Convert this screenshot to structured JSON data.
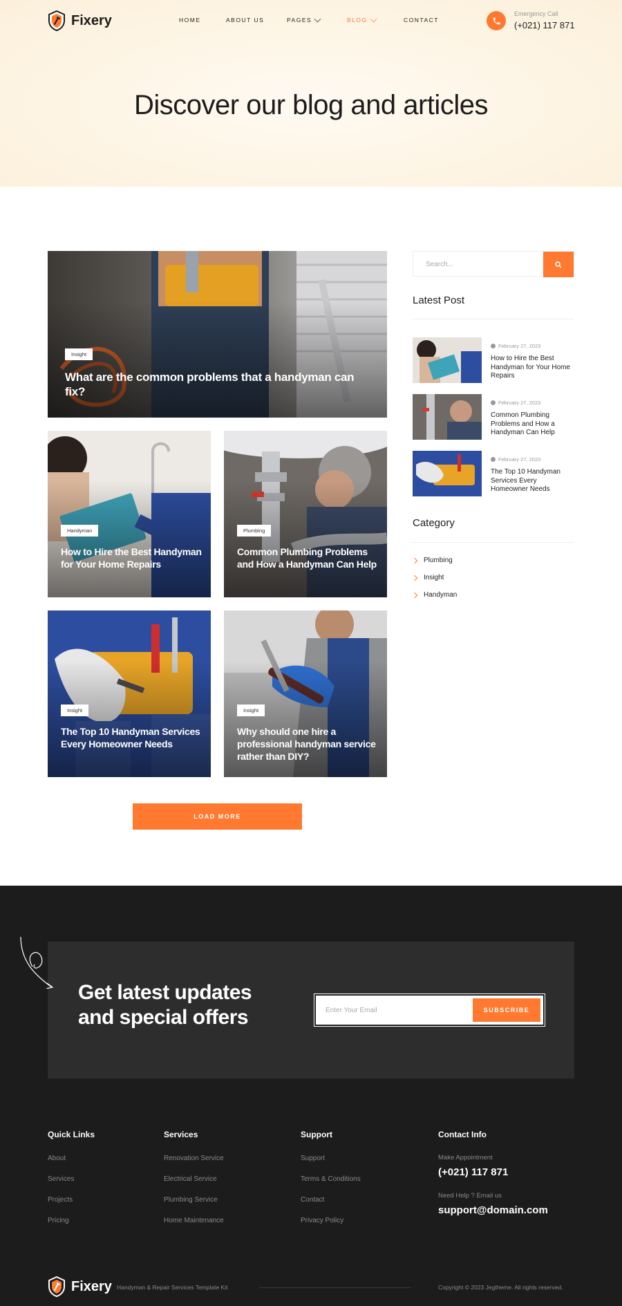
{
  "brand": {
    "name": "Fixery",
    "accent": "#ff7a30",
    "dark": "#1c1c1c"
  },
  "nav": {
    "items": [
      {
        "label": "HOME"
      },
      {
        "label": "ABOUT US"
      },
      {
        "label": "PAGES"
      },
      {
        "label": "BLOG"
      },
      {
        "label": "CONTACT"
      }
    ]
  },
  "emergency": {
    "label": "Emergency Call",
    "number": "(+021) 117 871"
  },
  "hero": {
    "title": "Discover our blog and articles"
  },
  "posts": [
    {
      "tag": "Insight",
      "title": "What are the common problems that a handyman can fix?"
    },
    {
      "tag": "Handyman",
      "title": "How to Hire the Best Handyman for Your Home Repairs"
    },
    {
      "tag": "Plumbing",
      "title": "Common Plumbing Problems and How a Handyman Can Help"
    },
    {
      "tag": "Insight",
      "title": "The Top 10 Handyman Services Every Homeowner Needs"
    },
    {
      "tag": "Insight",
      "title": "Why should one hire a professional handyman service rather than DIY?"
    }
  ],
  "load_more": "LOAD MORE",
  "sidebar": {
    "search_placeholder": "Search...",
    "latest_heading": "Latest Post",
    "latest": [
      {
        "date": "February 27, 2023",
        "title": "How to Hire the Best Handyman for Your Home Repairs"
      },
      {
        "date": "February 27, 2023",
        "title": "Common Plumbing Problems and How a Handyman Can Help"
      },
      {
        "date": "February 27, 2023",
        "title": "The Top 10 Handyman Services Every Homeowner Needs"
      }
    ],
    "category_heading": "Category",
    "categories": [
      "Plumbing",
      "Insight",
      "Handyman"
    ]
  },
  "newsletter": {
    "title": "Get latest updates and special offers",
    "placeholder": "Enter Your Email",
    "button": "SUBSCRIBE"
  },
  "footer": {
    "quick_links": {
      "heading": "Quick Links",
      "items": [
        "About",
        "Services",
        "Projects",
        "Pricing"
      ]
    },
    "services": {
      "heading": "Services",
      "items": [
        "Renovation Service",
        "Electrical Service",
        "Plumbing Service",
        "Home Maintenance"
      ]
    },
    "support": {
      "heading": "Support",
      "items": [
        "Support",
        "Terms & Conditions",
        "Contact",
        "Privacy Policy"
      ]
    },
    "contact": {
      "heading": "Contact Info",
      "appt_label": "Make Appointment",
      "phone": "(+021) 117 871",
      "help_label": "Need Help ? Email us",
      "email": "support@domain.com"
    },
    "tagline": "Handyman & Repair Services Template Kit",
    "copyright": "Copyright © 2023 Jegtheme. All rights reserved."
  }
}
